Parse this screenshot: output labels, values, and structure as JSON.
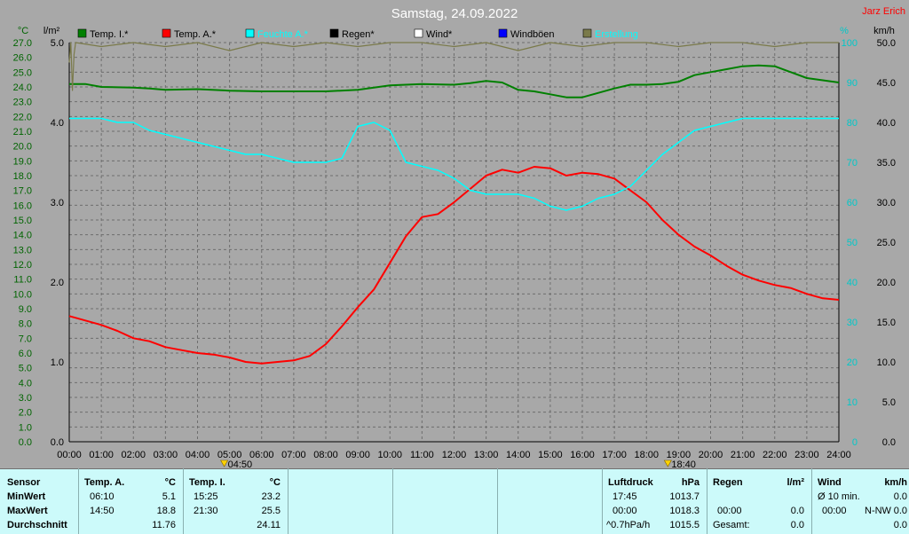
{
  "chart_data": {
    "type": "line",
    "title": "Samstag, 24.09.2022",
    "author": "Jarz Erich",
    "left_axis_units": [
      "°C",
      "l/m²"
    ],
    "right_axis_units": [
      "%",
      "km/h"
    ],
    "x_ticks": [
      "00:00",
      "01:00",
      "02:00",
      "03:00",
      "04:00",
      "05:00",
      "06:00",
      "07:00",
      "08:00",
      "09:00",
      "10:00",
      "11:00",
      "12:00",
      "13:00",
      "14:00",
      "15:00",
      "16:00",
      "17:00",
      "18:00",
      "19:00",
      "20:00",
      "21:00",
      "22:00",
      "23:00",
      "24:00"
    ],
    "temp_axis": {
      "range": [
        0,
        27
      ],
      "ticks": [
        "0.0",
        "1.0",
        "2.0",
        "3.0",
        "4.0",
        "5.0",
        "6.0",
        "7.0",
        "8.0",
        "9.0",
        "10.0",
        "11.0",
        "12.0",
        "13.0",
        "14.0",
        "15.0",
        "16.0",
        "17.0",
        "18.0",
        "19.0",
        "20.0",
        "21.0",
        "22.0",
        "23.0",
        "24.0",
        "25.0",
        "26.0",
        "27.0"
      ]
    },
    "rain_axis": {
      "range": [
        0,
        5
      ],
      "ticks": [
        "0.0",
        "1.0",
        "2.0",
        "3.0",
        "4.0",
        "5.0"
      ]
    },
    "humidity_axis": {
      "range": [
        0,
        100
      ],
      "ticks": [
        "0",
        "10",
        "20",
        "30",
        "40",
        "50",
        "60",
        "70",
        "80",
        "90",
        "100"
      ]
    },
    "wind_axis": {
      "range": [
        0,
        50
      ],
      "ticks": [
        "0.0",
        "5.0",
        "10.0",
        "15.0",
        "20.0",
        "25.0",
        "30.0",
        "35.0",
        "40.0",
        "45.0",
        "50.0"
      ]
    },
    "sunrise": "04:50",
    "sunset": "18:40",
    "legend": [
      {
        "label": "Temp. I.*",
        "color": "#008000"
      },
      {
        "label": "Temp. A.*",
        "color": "#ff0000"
      },
      {
        "label": "Feuchte A.*",
        "color": "#00ffff"
      },
      {
        "label": "Regen*",
        "color": "#000000"
      },
      {
        "label": "Wind*",
        "color": "#ffffff"
      },
      {
        "label": "Windböen",
        "color": "#0000ff"
      },
      {
        "label": "Erstellung",
        "color": "#7a7a4a"
      }
    ],
    "series": [
      {
        "name": "Temp. I.*",
        "axis": "temp",
        "color": "#008000",
        "x": [
          0,
          0.5,
          1,
          2,
          2.5,
          3,
          4,
          5,
          6,
          7,
          8,
          9,
          10,
          11,
          12,
          12.5,
          13,
          13.5,
          14,
          14.5,
          15,
          15.5,
          16,
          16.5,
          17,
          17.5,
          18,
          18.5,
          19,
          19.5,
          20,
          20.5,
          21,
          21.5,
          22,
          22.5,
          23,
          23.5,
          24
        ],
        "y": [
          24.2,
          24.2,
          24.0,
          23.95,
          23.9,
          23.8,
          23.85,
          23.75,
          23.7,
          23.7,
          23.7,
          23.8,
          24.1,
          24.2,
          24.15,
          24.25,
          24.4,
          24.3,
          23.8,
          23.7,
          23.5,
          23.3,
          23.3,
          23.6,
          23.9,
          24.15,
          24.15,
          24.2,
          24.35,
          24.8,
          25.0,
          25.2,
          25.4,
          25.45,
          25.4,
          25.0,
          24.6,
          24.45,
          24.3
        ]
      },
      {
        "name": "Temp. A.*",
        "axis": "temp",
        "color": "#ff0000",
        "x": [
          0,
          0.5,
          1,
          1.5,
          2,
          2.5,
          3,
          3.5,
          4,
          4.5,
          5,
          5.5,
          6,
          6.5,
          7,
          7.5,
          8,
          8.5,
          9,
          9.5,
          10,
          10.5,
          11,
          11.5,
          12,
          12.5,
          13,
          13.5,
          14,
          14.5,
          15,
          15.5,
          16,
          16.5,
          17,
          17.5,
          18,
          18.5,
          19,
          19.5,
          20,
          20.5,
          21,
          21.5,
          22,
          22.5,
          23,
          23.5,
          24
        ],
        "y": [
          8.5,
          8.2,
          7.9,
          7.5,
          7.0,
          6.8,
          6.4,
          6.2,
          6.0,
          5.9,
          5.7,
          5.4,
          5.3,
          5.4,
          5.5,
          5.8,
          6.6,
          7.8,
          9.1,
          10.3,
          12.1,
          13.9,
          15.2,
          15.4,
          16.2,
          17.1,
          18.0,
          18.4,
          18.2,
          18.6,
          18.5,
          18.0,
          18.2,
          18.1,
          17.8,
          17.0,
          16.2,
          15.0,
          14.0,
          13.2,
          12.6,
          11.9,
          11.3,
          10.9,
          10.6,
          10.4,
          10.0,
          9.7,
          9.6
        ]
      },
      {
        "name": "Feuchte A.*",
        "axis": "humidity",
        "color": "#00ffff",
        "x": [
          0,
          0.5,
          1,
          1.5,
          2,
          2.5,
          3,
          3.5,
          4,
          4.5,
          5,
          5.5,
          6,
          6.5,
          7,
          7.5,
          8,
          8.5,
          9,
          9.5,
          10,
          10.5,
          11,
          11.5,
          12,
          12.5,
          13,
          13.5,
          14,
          14.5,
          15,
          15.5,
          16,
          16.5,
          17,
          17.5,
          18,
          18.5,
          19,
          19.5,
          20,
          20.5,
          21,
          21.5,
          22,
          22.5,
          23,
          23.5,
          24
        ],
        "y": [
          81,
          81,
          81,
          80,
          80,
          78,
          77,
          76,
          75,
          74,
          73,
          72,
          72,
          71,
          70,
          70,
          70,
          71,
          79,
          80,
          78,
          70,
          69,
          68,
          66,
          63,
          62,
          62,
          62,
          61,
          59,
          58,
          59,
          61,
          62,
          64,
          68,
          72,
          75,
          78,
          79,
          80,
          81,
          81,
          81,
          81,
          81,
          81,
          81
        ]
      },
      {
        "name": "Erstellung",
        "axis": "humidity",
        "color": "#7a7a4a",
        "x": [
          0,
          0.05,
          0.1,
          0.15,
          0.2,
          1,
          2,
          3,
          4,
          5,
          6,
          7,
          8,
          9,
          10,
          11,
          12,
          13,
          14,
          15,
          16,
          17,
          18,
          19,
          20,
          21,
          22,
          23,
          24
        ],
        "y": [
          95,
          100,
          88,
          97,
          100,
          99,
          100,
          99,
          100,
          98,
          100,
          99,
          100,
          99,
          100,
          100,
          99,
          100,
          98,
          100,
          99,
          100,
          100,
          99,
          100,
          100,
          99,
          100,
          100
        ]
      }
    ]
  },
  "table": {
    "col1": {
      "header": "Sensor",
      "rows": [
        "MinWert",
        "MaxWert",
        "Durchschnitt"
      ]
    },
    "temp_a": {
      "header": "Temp. A.",
      "unit": "°C",
      "times": [
        "06:10",
        "14:50"
      ],
      "values": [
        "5.1",
        "18.8",
        "11.76"
      ]
    },
    "temp_i": {
      "header": "Temp. I.",
      "unit": "°C",
      "times": [
        "15:25",
        "21:30"
      ],
      "values": [
        "23.2",
        "25.5",
        "24.11"
      ]
    },
    "luftdruck": {
      "header": "Luftdruck",
      "unit": "hPa",
      "times": [
        "17:45",
        "00:00",
        "^0.7hPa/h"
      ],
      "values": [
        "1013.7",
        "1018.3",
        "1015.5"
      ]
    },
    "regen": {
      "header": "Regen",
      "unit": "l/m²",
      "times": [
        "",
        "00:00",
        "Gesamt:"
      ],
      "values": [
        "",
        "0.0",
        "0.0"
      ]
    },
    "wind": {
      "header": "Wind",
      "unit": "km/h",
      "times": [
        "Ø 10 min.",
        "00:00",
        ""
      ],
      "dirs": [
        "",
        "N-NW",
        ""
      ],
      "values": [
        "0.0",
        "0.0",
        "0.0"
      ]
    }
  }
}
